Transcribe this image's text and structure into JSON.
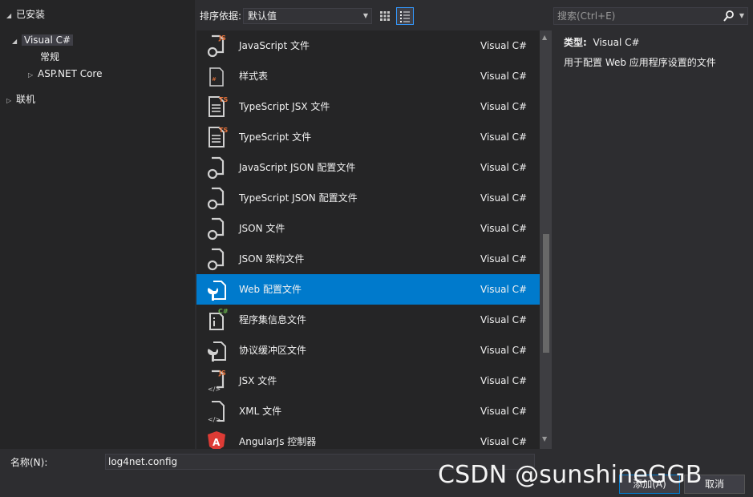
{
  "sidebar": {
    "installed": "已安装",
    "items": [
      {
        "label": "Visual C#"
      },
      {
        "label": "常规"
      },
      {
        "label": "ASP.NET Core"
      }
    ],
    "online": "联机"
  },
  "toolbar": {
    "sort_label": "排序依据:",
    "sort_value": "默认值",
    "search_placeholder": "搜索(Ctrl+E)"
  },
  "templates": [
    {
      "name": "JavaScript 文件",
      "lang": "Visual C#",
      "icon": "javascript-file-icon"
    },
    {
      "name": "样式表",
      "lang": "Visual C#",
      "icon": "stylesheet-icon"
    },
    {
      "name": "TypeScript JSX 文件",
      "lang": "Visual C#",
      "icon": "typescript-jsx-file-icon"
    },
    {
      "name": "TypeScript 文件",
      "lang": "Visual C#",
      "icon": "typescript-file-icon"
    },
    {
      "name": "JavaScript JSON 配置文件",
      "lang": "Visual C#",
      "icon": "json-config-icon"
    },
    {
      "name": "TypeScript JSON 配置文件",
      "lang": "Visual C#",
      "icon": "json-config-icon"
    },
    {
      "name": "JSON 文件",
      "lang": "Visual C#",
      "icon": "json-file-icon"
    },
    {
      "name": "JSON 架构文件",
      "lang": "Visual C#",
      "icon": "json-schema-icon"
    },
    {
      "name": "Web 配置文件",
      "lang": "Visual C#",
      "icon": "web-config-icon",
      "selected": true
    },
    {
      "name": "程序集信息文件",
      "lang": "Visual C#",
      "icon": "assembly-info-icon"
    },
    {
      "name": "协议缓冲区文件",
      "lang": "Visual C#",
      "icon": "protocol-buffer-icon"
    },
    {
      "name": "JSX 文件",
      "lang": "Visual C#",
      "icon": "jsx-file-icon"
    },
    {
      "name": "XML 文件",
      "lang": "Visual C#",
      "icon": "xml-file-icon"
    },
    {
      "name": "AngularJs 控制器",
      "lang": "Visual C#",
      "icon": "angular-icon"
    }
  ],
  "details": {
    "type_label": "类型:",
    "type_value": "Visual C#",
    "description": "用于配置 Web 应用程序设置的文件"
  },
  "footer": {
    "name_label": "名称(N):",
    "name_value": "log4net.config",
    "add_label": "添加(A)",
    "cancel_label": "取消"
  },
  "watermark": "CSDN @sunshineGGB",
  "colors": {
    "accent": "#007acc",
    "background": "#2d2d30",
    "panel": "#252526",
    "ts_badge": "#e8733a",
    "cs_badge": "#68b04d",
    "angular": "#dd3b35"
  }
}
